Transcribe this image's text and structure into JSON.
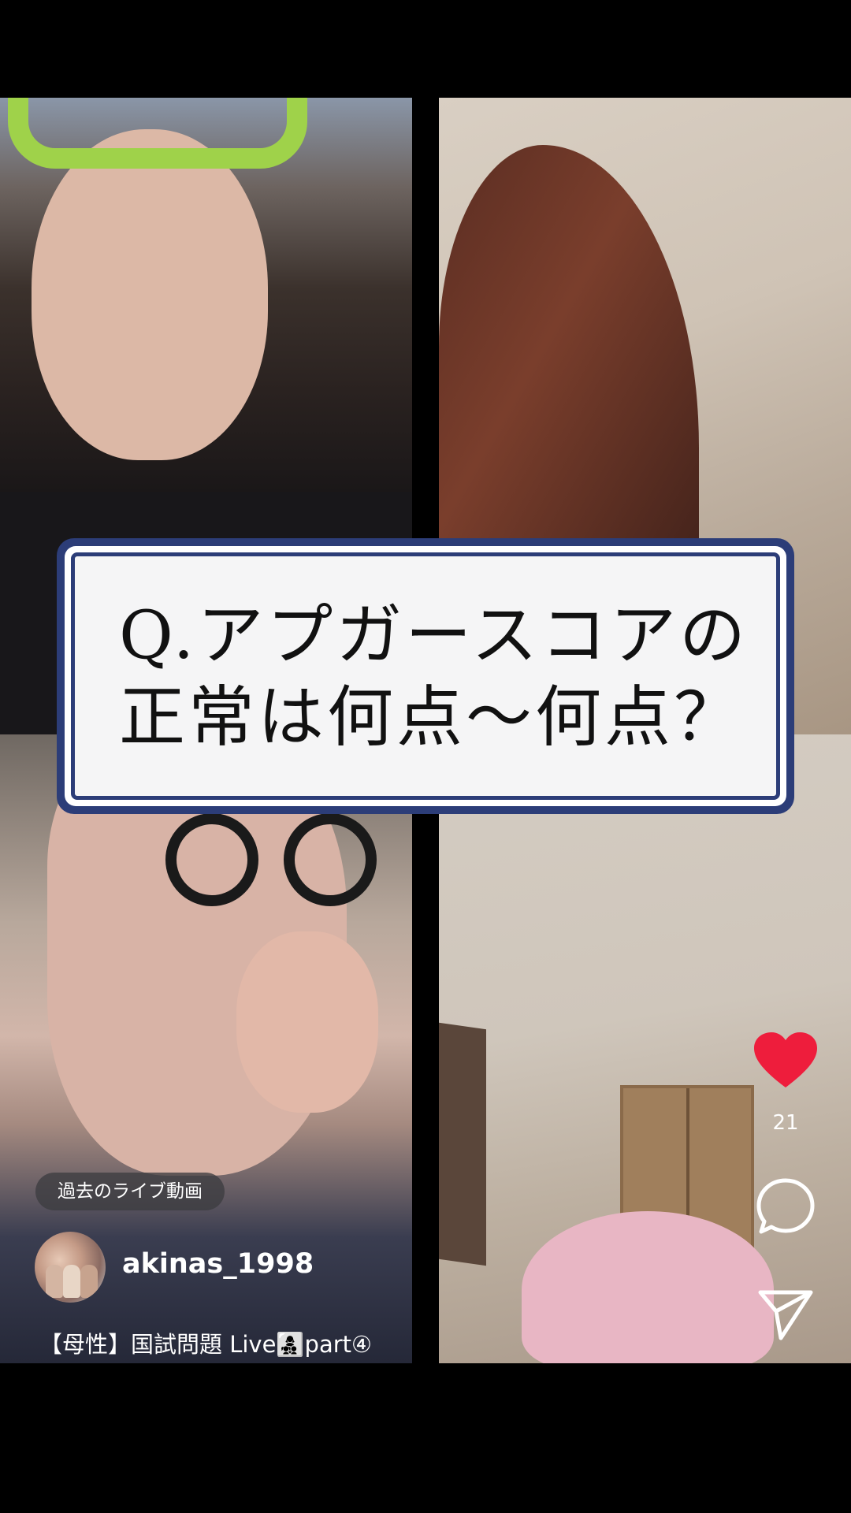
{
  "question": {
    "line1": "Q.アプガースコアの",
    "line2": "正常は何点〜何点？"
  },
  "actions": {
    "like_icon": "heart-icon",
    "like_count": "21",
    "comment_icon": "comment-bubble-icon",
    "share_icon": "send-icon",
    "like_color": "#ee1d3c"
  },
  "post": {
    "badge": "過去のライブ動画",
    "username": "akinas_1998",
    "title": "【母性】国試問題 Live👩‍👧‍👦part④"
  },
  "feeds": [
    "participant-video-1",
    "participant-video-2",
    "participant-video-3",
    "participant-video-4"
  ]
}
